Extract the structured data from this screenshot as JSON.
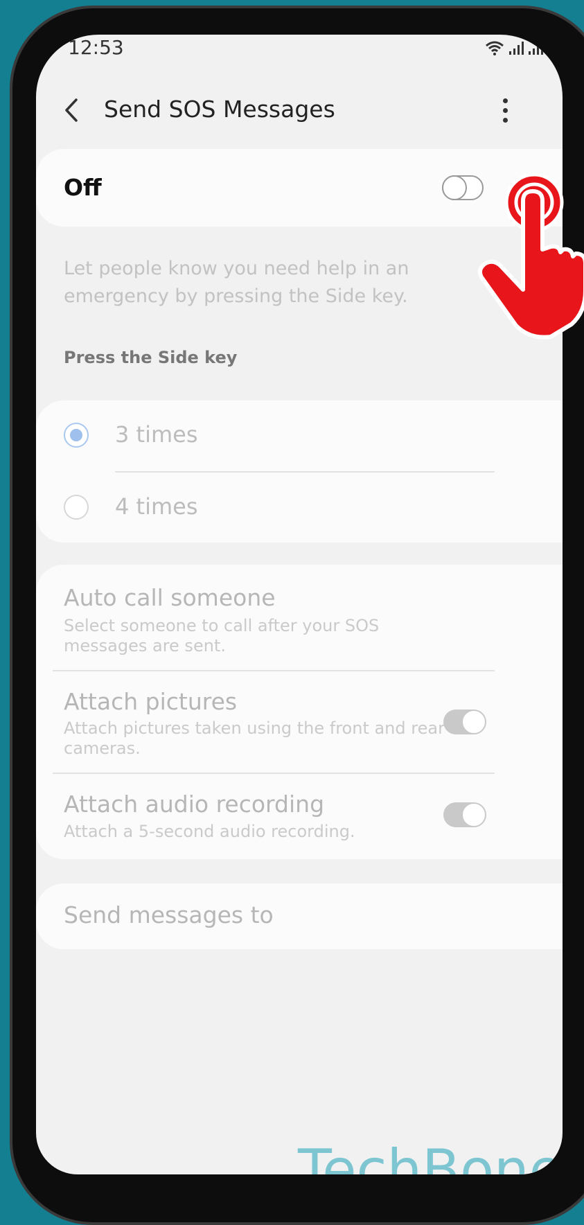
{
  "status_bar": {
    "time": "12:53"
  },
  "header": {
    "title": "Send SOS Messages"
  },
  "master_switch": {
    "label": "Off",
    "on": false
  },
  "description": "Let people know you need help in an emergency by pressing the Side key.",
  "press_side_key": {
    "section_label": "Press the Side key",
    "options": [
      {
        "label": "3 times",
        "selected": true
      },
      {
        "label": "4 times",
        "selected": false
      }
    ]
  },
  "options": {
    "auto_call": {
      "title": "Auto call someone",
      "subtitle": "Select someone to call after your SOS messages are sent."
    },
    "attach_pictures": {
      "title": "Attach pictures",
      "subtitle": "Attach pictures taken using the front and rear cameras.",
      "on": true
    },
    "attach_audio": {
      "title": "Attach audio recording",
      "subtitle": "Attach a 5-second audio recording.",
      "on": true
    }
  },
  "send_messages_to": {
    "label": "Send messages to"
  },
  "watermark": "TechBone",
  "colors": {
    "background": "#157f92",
    "tap_hand": "#e8151b",
    "watermark": "#7dc6d1"
  }
}
